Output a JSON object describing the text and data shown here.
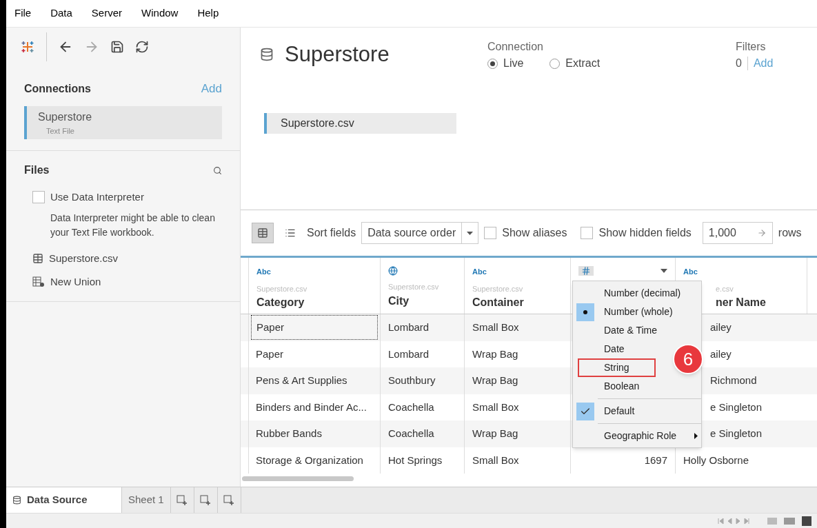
{
  "menu_bar": [
    "File",
    "Data",
    "Server",
    "Window",
    "Help"
  ],
  "sidebar": {
    "connections": {
      "title": "Connections",
      "add": "Add",
      "items": [
        {
          "name": "Superstore",
          "type": "Text File",
          "selected": true
        }
      ]
    },
    "files": {
      "title": "Files",
      "interpreter": {
        "label": "Use Data Interpreter",
        "checked": false,
        "note": "Data Interpreter might be able to clean your Text File workbook."
      },
      "items": [
        {
          "kind": "table",
          "label": "Superstore.csv"
        },
        {
          "kind": "union",
          "label": "New Union"
        }
      ]
    }
  },
  "datasource": {
    "title": "Superstore",
    "connection": {
      "label": "Connection",
      "options": [
        {
          "label": "Live",
          "selected": true
        },
        {
          "label": "Extract",
          "selected": false
        }
      ]
    },
    "filters": {
      "label": "Filters",
      "count": "0",
      "add": "Add"
    },
    "canvas_table": "Superstore.csv"
  },
  "toolbar": {
    "views": [
      {
        "kind": "grid",
        "selected": true
      },
      {
        "kind": "list",
        "selected": false
      }
    ],
    "sort_label": "Sort fields",
    "sort_value": "Data source order",
    "show_aliases": {
      "label": "Show aliases",
      "checked": false
    },
    "show_hidden": {
      "label": "Show hidden fields",
      "checked": false
    },
    "rows_value": "1,000",
    "rows_label": "rows"
  },
  "table": {
    "columns": [
      {
        "kind": "string",
        "type_label": "Abc",
        "source": "Superstore.csv",
        "name": "Category"
      },
      {
        "kind": "geo",
        "source": "Superstore.csv",
        "name": "City"
      },
      {
        "kind": "string",
        "type_label": "Abc",
        "source": "Superstore.csv",
        "name": "Container"
      },
      {
        "kind": "number",
        "menu_open": true
      },
      {
        "kind": "string",
        "type_label": "Abc",
        "source": "e.csv",
        "name": "ner Name"
      }
    ],
    "rows": [
      {
        "category": "Paper",
        "city": "Lombard",
        "container": "Small Box",
        "column_5": "ailey",
        "focused": true
      },
      {
        "category": "Paper",
        "city": "Lombard",
        "container": "Wrap Bag",
        "column_5": "ailey",
        "focused": false
      },
      {
        "category": "Pens & Art Supplies",
        "city": "Southbury",
        "container": "Wrap Bag",
        "column_5": "Richmond",
        "focused": false
      },
      {
        "category": "Binders and Binder Ac...",
        "city": "Coachella",
        "container": "Small Box",
        "column_5": "e Singleton",
        "focused": false
      },
      {
        "category": "Rubber Bands",
        "city": "Coachella",
        "container": "Wrap Bag",
        "column_5": "e Singleton",
        "focused": false
      },
      {
        "category": "Storage & Organization",
        "city": "Hot Springs",
        "container": "Small Box",
        "column_4": "1697",
        "column_5": "Holly Osborne",
        "focused": false
      }
    ]
  },
  "type_menu": {
    "types": [
      {
        "label": "Number (decimal)",
        "selected": false,
        "highlighted": false
      },
      {
        "label": "Number (whole)",
        "selected": true,
        "highlighted": false
      },
      {
        "label": "Date & Time",
        "selected": false,
        "highlighted": false
      },
      {
        "label": "Date",
        "selected": false,
        "highlighted": false
      },
      {
        "label": "String",
        "selected": false,
        "highlighted": true
      },
      {
        "label": "Boolean",
        "selected": false,
        "highlighted": false
      }
    ],
    "default": {
      "label": "Default",
      "checked": true
    },
    "submenu": {
      "label": "Geographic Role"
    },
    "step_badge": "6"
  },
  "bottom_tabs": [
    {
      "kind": "datasource",
      "label": "Data Source",
      "selected": true
    },
    {
      "kind": "sheet",
      "label": "Sheet 1",
      "selected": false
    }
  ]
}
